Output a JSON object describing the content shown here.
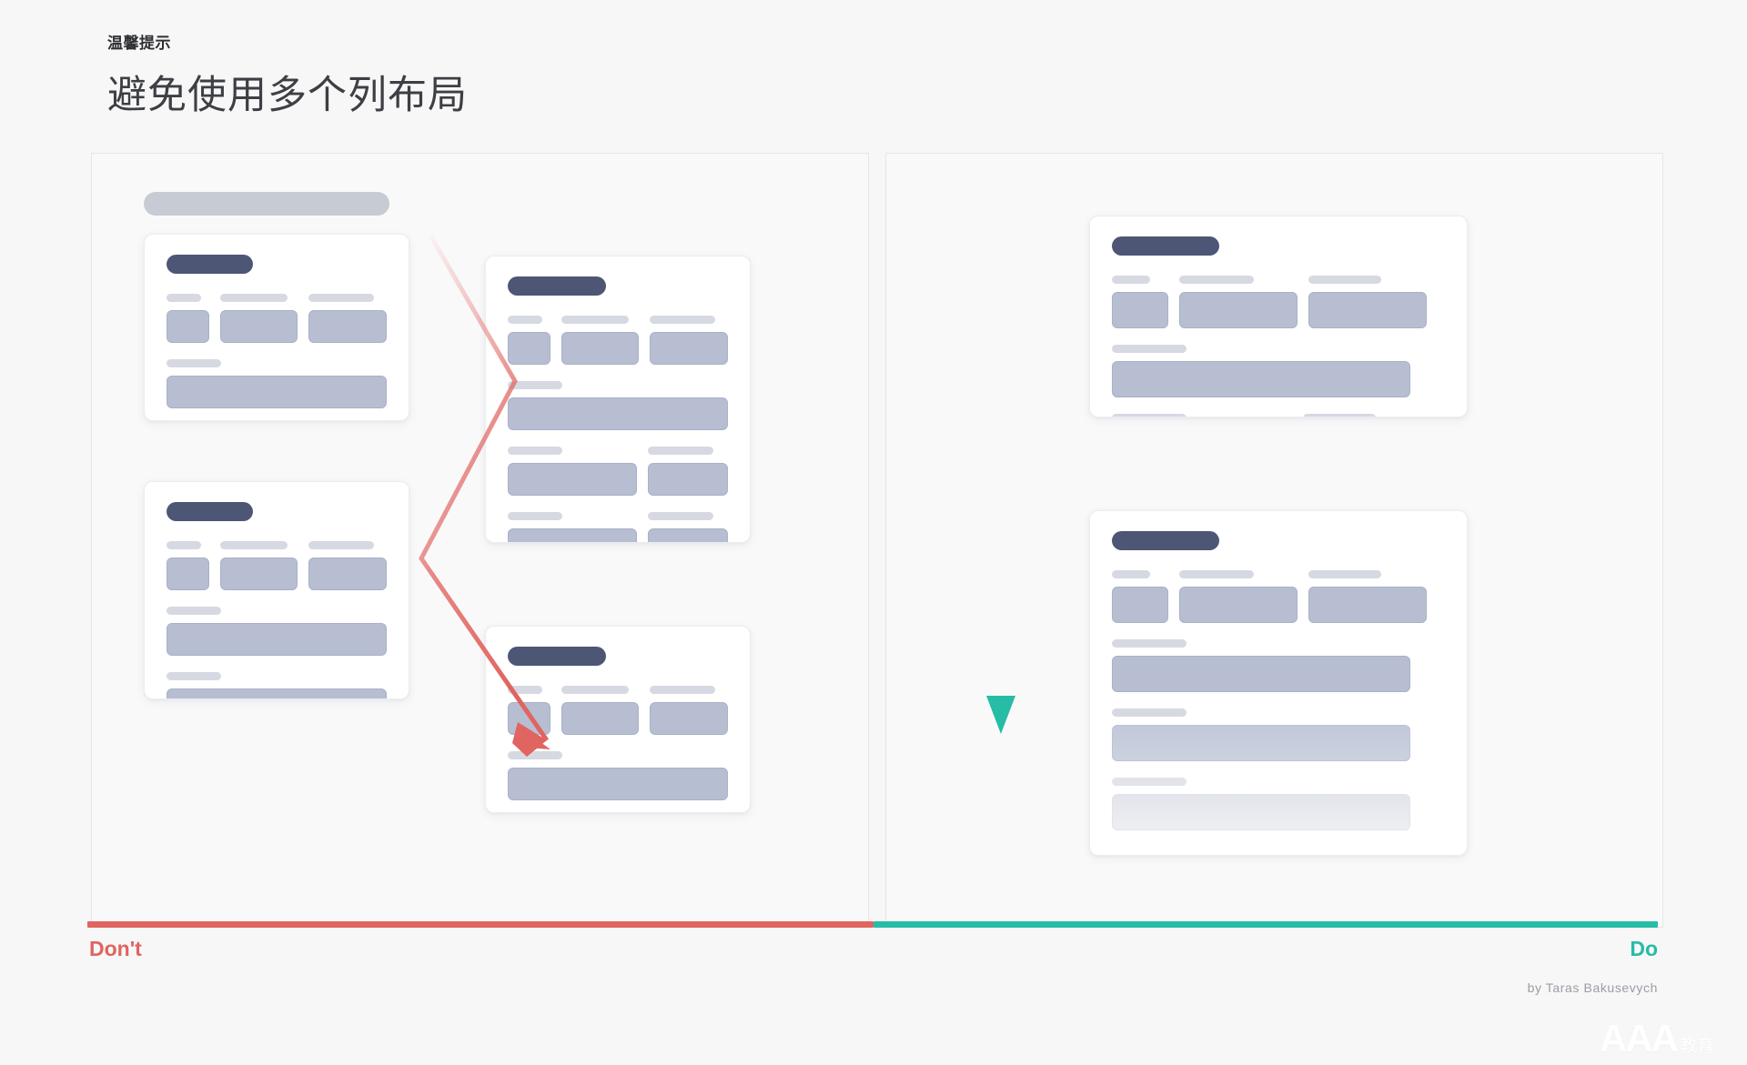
{
  "header": {
    "kicker": "温馨提示",
    "title": "避免使用多个列布局"
  },
  "footer": {
    "dont_label": "Don't",
    "do_label": "Do",
    "credit": "by Taras Bakusevych",
    "watermark": "AAA",
    "watermark_cn": "教育"
  },
  "colors": {
    "page_background": "#f7f7f8",
    "panel_background": "#f9f9fa",
    "panel_border": "#e6e6e8",
    "card_background": "#ffffff",
    "card_title_pill": "#4e5676",
    "field_fill": "#b7bed2",
    "field_border": "#a9b1c7",
    "label_bar": "#d6d9e1",
    "top_pill": "#c7cbd4",
    "dont_accent": "#e0645f",
    "do_accent": "#26bca6"
  },
  "dont_panel": {
    "name": "Don't",
    "top_pill": "page-title-placeholder",
    "arrow": {
      "type": "zigzag-arrow",
      "direction": "multi-column-zigzag-scan",
      "color": "#e0645f"
    },
    "cards": [
      {
        "id": "dont-card-1",
        "title_pill_width": 95,
        "rows": [
          {
            "type": "three-col",
            "widths": [
              52,
              94,
              96
            ]
          },
          {
            "type": "full",
            "widths": [
              244
            ]
          },
          {
            "type": "two-col",
            "widths": [
              148,
              92
            ]
          }
        ]
      },
      {
        "id": "dont-card-2",
        "title_pill_width": 95,
        "rows": [
          {
            "type": "three-col",
            "widths": [
              52,
              94,
              96
            ]
          },
          {
            "type": "full",
            "widths": [
              244
            ]
          },
          {
            "type": "full",
            "widths": [
              244
            ]
          },
          {
            "type": "full",
            "widths": [
              244
            ]
          }
        ]
      },
      {
        "id": "dont-card-3",
        "title_pill_width": 108,
        "rows": [
          {
            "type": "three-col",
            "widths": [
              52,
              94,
              96
            ]
          },
          {
            "type": "full",
            "widths": [
              244
            ]
          },
          {
            "type": "two-col",
            "widths": [
              148,
              92
            ]
          },
          {
            "type": "two-col",
            "widths": [
              148,
              92
            ]
          },
          {
            "type": "two-col",
            "widths": [
              148,
              92
            ]
          }
        ]
      },
      {
        "id": "dont-card-4",
        "title_pill_width": 108,
        "rows": [
          {
            "type": "three-col",
            "widths": [
              52,
              94,
              96
            ]
          },
          {
            "type": "full",
            "widths": [
              244
            ]
          },
          {
            "type": "two-col",
            "widths": [
              148,
              92
            ]
          }
        ]
      }
    ]
  },
  "do_panel": {
    "name": "Do",
    "arrow": {
      "type": "straight-arrow",
      "direction": "single-column-vertical-scan",
      "color": "#26bca6"
    },
    "cards": [
      {
        "id": "do-card-1",
        "title_pill_width": 118,
        "rows": [
          {
            "type": "three-col",
            "widths": [
              62,
              130,
              130
            ]
          },
          {
            "type": "full",
            "widths": [
              328
            ]
          },
          {
            "type": "two-col",
            "widths": [
              198,
              120
            ]
          }
        ]
      },
      {
        "id": "do-card-2",
        "title_pill_width": 118,
        "rows": [
          {
            "type": "three-col",
            "widths": [
              62,
              130,
              130
            ]
          },
          {
            "type": "full",
            "widths": [
              328
            ]
          },
          {
            "type": "full-faded",
            "widths": [
              328
            ]
          },
          {
            "type": "full-faded-2",
            "widths": [
              328
            ]
          }
        ]
      }
    ]
  }
}
